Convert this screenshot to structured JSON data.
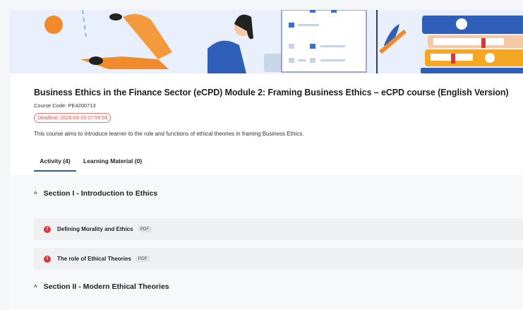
{
  "course": {
    "title": "Business Ethics in the Finance Sector (eCPD) Module 2: Framing Business Ethics – eCPD course (English Version)",
    "code": "Course Code: PE4200713",
    "deadline": "Deadline: 2026-03-23 07:59:59",
    "description": "This course aims to introduce learner to the role and functions of ethical theories in framing Business Ethics."
  },
  "tabs": [
    {
      "label": "Activity (4)",
      "active": true
    },
    {
      "label": "Learning Material (0)",
      "active": false
    }
  ],
  "sections": [
    {
      "title": "Section I - Introduction to Ethics",
      "items": [
        {
          "title": "Defining Morality and Ethics",
          "badge": "PDF",
          "status_icon": "alert-icon"
        },
        {
          "title": "The role of Ethical Theories",
          "badge": "PDF",
          "status_icon": "alert-icon"
        }
      ]
    },
    {
      "title": "Section II - Modern Ethical Theories",
      "items": []
    }
  ],
  "colors": {
    "accent": "#2a5db0",
    "deadline": "#d9534f",
    "alert": "#d9363e"
  }
}
